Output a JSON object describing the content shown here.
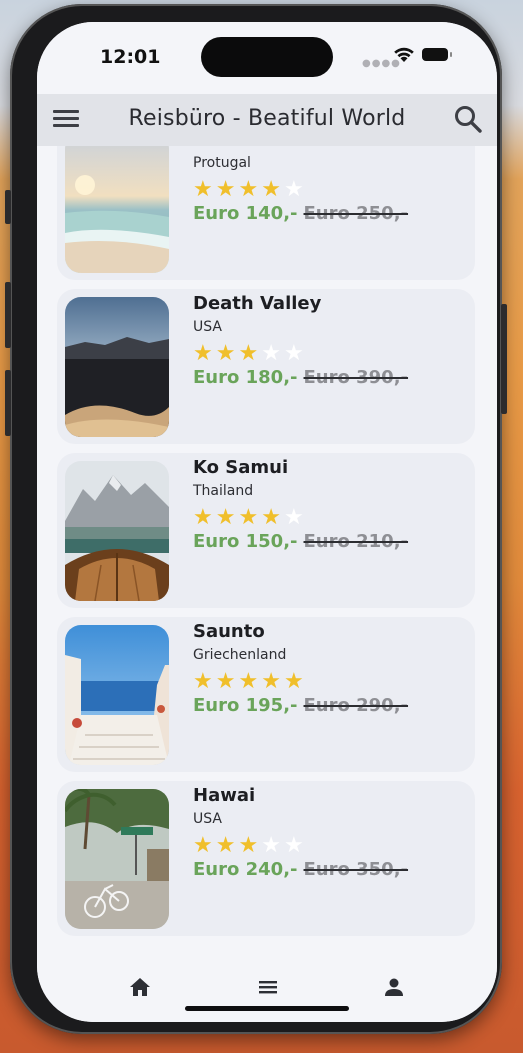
{
  "status_bar": {
    "time": "12:01"
  },
  "app_bar": {
    "title": "Reisbüro - Beatiful World"
  },
  "trips": [
    {
      "name": "",
      "country": "Protugal",
      "rating": 4,
      "price": "Euro 140,-",
      "old_price": "Euro 250,-",
      "image": "beach-sunset"
    },
    {
      "name": "Death Valley",
      "country": "USA",
      "rating": 3,
      "price": "Euro 180,-",
      "old_price": "Euro 390,-",
      "image": "desert-dunes"
    },
    {
      "name": "Ko Samui",
      "country": "Thailand",
      "rating": 4,
      "price": "Euro 150,-",
      "old_price": "Euro 210,-",
      "image": "mountain-lake-boat"
    },
    {
      "name": "Saunto",
      "country": "Griechenland",
      "rating": 5,
      "price": "Euro 195,-",
      "old_price": "Euro 290,-",
      "image": "santorini-stairs"
    },
    {
      "name": "Hawai",
      "country": "USA",
      "rating": 3,
      "price": "Euro 240,-",
      "old_price": "Euro 350,-",
      "image": "palm-street-bicycle"
    }
  ],
  "bottom_nav": [
    "home-icon",
    "list-icon",
    "person-icon"
  ],
  "colors": {
    "price": "#6aa45a",
    "star": "#f0bf2b",
    "app_bar": "#e1e3e8",
    "background": "#f4f5f9"
  }
}
